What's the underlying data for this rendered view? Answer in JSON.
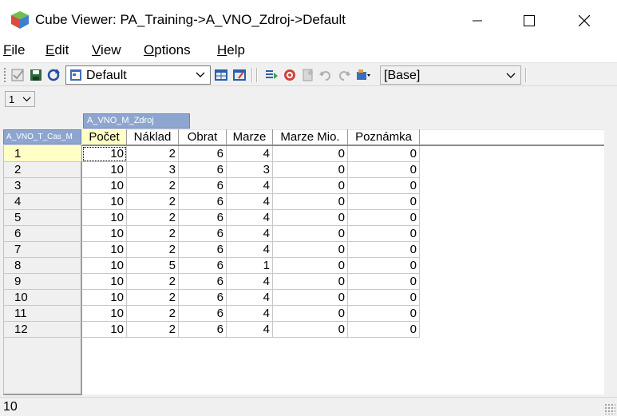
{
  "window": {
    "title": "Cube Viewer: PA_Training->A_VNO_Zdroj->Default"
  },
  "menu": {
    "items": [
      {
        "label_u": "F",
        "label_rest": "ile"
      },
      {
        "label_u": "E",
        "label_rest": "dit"
      },
      {
        "label_u": "V",
        "label_rest": "iew"
      },
      {
        "label_u": "O",
        "label_rest": "ptions"
      },
      {
        "label_u": "H",
        "label_rest": "elp"
      }
    ]
  },
  "toolbar": {
    "view_name": "Default",
    "subset": "[Base]",
    "icons": [
      "check-icon",
      "save-icon",
      "recalculate-icon",
      "view-icon",
      "export-icon",
      "slice-icon",
      "stop-icon",
      "sandbox-icon",
      "undo-icon",
      "redo-icon",
      "settings-icon"
    ]
  },
  "title_dimension": {
    "selected": "1"
  },
  "column_dimension": "A_VNO_M_Zdroj",
  "row_dimension": "A_VNO_T_Cas_M",
  "columns": [
    "Počet",
    "Náklad",
    "Obrat",
    "Marze",
    "Marze Mio.",
    "Poznámka"
  ],
  "rows": [
    {
      "label": "1",
      "values": [
        "10",
        "2",
        "6",
        "4",
        "0",
        "0"
      ]
    },
    {
      "label": "2",
      "values": [
        "10",
        "3",
        "6",
        "3",
        "0",
        "0"
      ]
    },
    {
      "label": "3",
      "values": [
        "10",
        "2",
        "6",
        "4",
        "0",
        "0"
      ]
    },
    {
      "label": "4",
      "values": [
        "10",
        "2",
        "6",
        "4",
        "0",
        "0"
      ]
    },
    {
      "label": "5",
      "values": [
        "10",
        "2",
        "6",
        "4",
        "0",
        "0"
      ]
    },
    {
      "label": "6",
      "values": [
        "10",
        "2",
        "6",
        "4",
        "0",
        "0"
      ]
    },
    {
      "label": "7",
      "values": [
        "10",
        "2",
        "6",
        "4",
        "0",
        "0"
      ]
    },
    {
      "label": "8",
      "values": [
        "10",
        "5",
        "6",
        "1",
        "0",
        "0"
      ]
    },
    {
      "label": "9",
      "values": [
        "10",
        "2",
        "6",
        "4",
        "0",
        "0"
      ]
    },
    {
      "label": "10",
      "values": [
        "10",
        "2",
        "6",
        "4",
        "0",
        "0"
      ]
    },
    {
      "label": "11",
      "values": [
        "10",
        "2",
        "6",
        "4",
        "0",
        "0"
      ]
    },
    {
      "label": "12",
      "values": [
        "10",
        "2",
        "6",
        "4",
        "0",
        "0"
      ]
    }
  ],
  "status": {
    "text": "10"
  }
}
